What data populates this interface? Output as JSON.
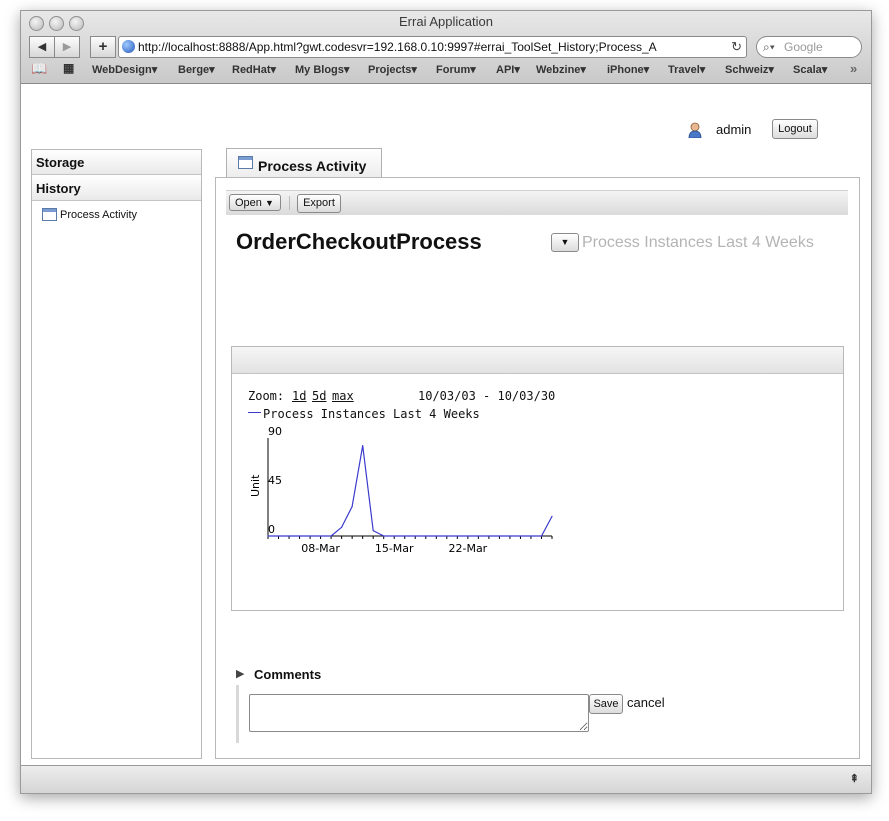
{
  "window": {
    "title": "Errai Application"
  },
  "browser": {
    "url": "http://localhost:8888/App.html?gwt.codesvr=192.168.0.10:9997#errai_ToolSet_History;Process_A",
    "search_placeholder": "Google",
    "bookmarks": [
      "WebDesign▾",
      "Berge▾",
      "RedHat▾",
      "My Blogs▾",
      "Projects▾",
      "Forum▾",
      "API▾",
      "Webzine▾",
      "iPhone▾",
      "Travel▾",
      "Schweiz▾",
      "Scala▾"
    ],
    "bookmarks_more": "»"
  },
  "header": {
    "user": "admin",
    "logout_label": "Logout"
  },
  "sidebar": {
    "sections": [
      "Storage",
      "History"
    ],
    "items": [
      {
        "label": "Process Activity"
      }
    ]
  },
  "main": {
    "tab_label": "Process Activity",
    "toolbar": {
      "open_label": "Open",
      "export_label": "Export"
    },
    "process_title": "OrderCheckoutProcess",
    "report_selector_label": "Process Instances Last 4 Weeks",
    "chart": {
      "zoom_label": "Zoom:",
      "zoom_options": [
        "1d",
        "5d",
        "max"
      ],
      "date_range": "10/03/03 - 10/03/30",
      "legend": "Process Instances Last 4 Weeks",
      "ylabel": "Unit",
      "yticks": [
        "90",
        "45",
        "0"
      ],
      "xticks": [
        "08-Mar",
        "15-Mar",
        "22-Mar"
      ]
    },
    "comments": {
      "label": "Comments",
      "save_label": "Save",
      "cancel_label": "cancel"
    }
  },
  "colors": {
    "series": "#3b3bcc",
    "axis": "#000000"
  },
  "chart_data": {
    "type": "line",
    "title": "",
    "legend": [
      "Process Instances Last 4 Weeks"
    ],
    "xlabel": "",
    "ylabel": "Unit",
    "ylim": [
      0,
      90
    ],
    "x": [
      "03-Mar",
      "04-Mar",
      "05-Mar",
      "06-Mar",
      "07-Mar",
      "08-Mar",
      "09-Mar",
      "10-Mar",
      "11-Mar",
      "12-Mar",
      "13-Mar",
      "14-Mar",
      "15-Mar",
      "16-Mar",
      "17-Mar",
      "18-Mar",
      "19-Mar",
      "20-Mar",
      "21-Mar",
      "22-Mar",
      "23-Mar",
      "24-Mar",
      "25-Mar",
      "26-Mar",
      "27-Mar",
      "28-Mar",
      "29-Mar",
      "30-Mar"
    ],
    "series": [
      {
        "name": "Process Instances Last 4 Weeks",
        "values": [
          0,
          0,
          0,
          0,
          0,
          0,
          0,
          8,
          27,
          83,
          5,
          0,
          0,
          0,
          0,
          0,
          0,
          0,
          0,
          0,
          0,
          0,
          0,
          0,
          0,
          0,
          0,
          18
        ]
      }
    ],
    "xticks": [
      "08-Mar",
      "15-Mar",
      "22-Mar"
    ],
    "yticks": [
      0,
      45,
      90
    ]
  }
}
